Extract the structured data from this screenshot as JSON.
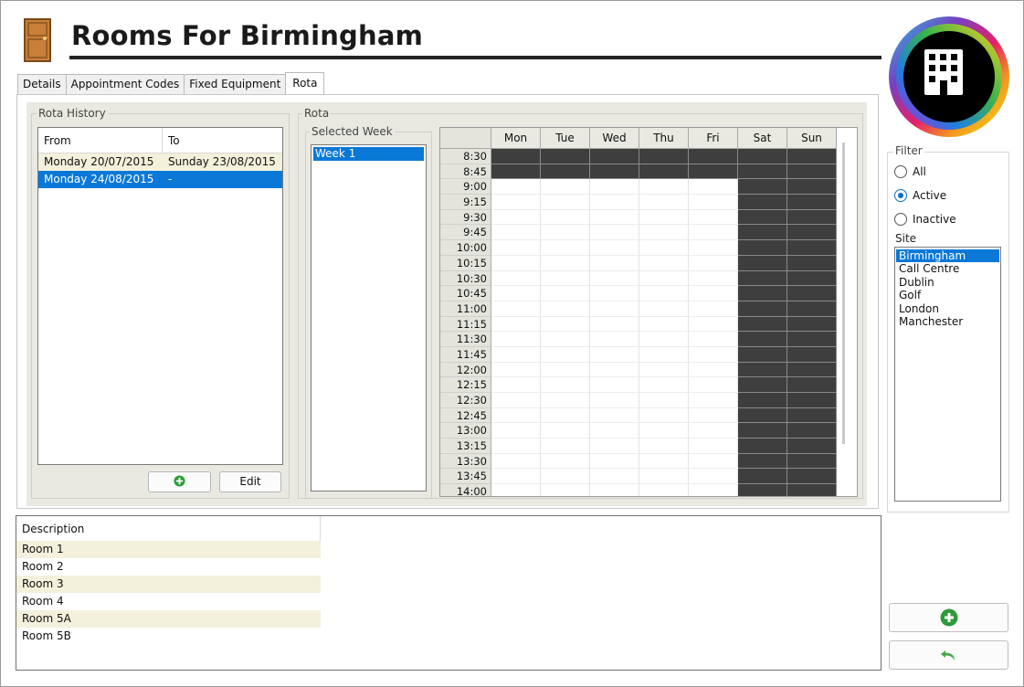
{
  "header": {
    "title": "Rooms For Birmingham"
  },
  "tabs": [
    {
      "label": "Details",
      "active": false
    },
    {
      "label": "Appointment Codes",
      "active": false
    },
    {
      "label": "Fixed Equipment",
      "active": false
    },
    {
      "label": "Rota",
      "active": true
    }
  ],
  "rota_history": {
    "group_label": "Rota History",
    "columns": [
      "From",
      "To"
    ],
    "rows": [
      {
        "from": "Monday 20/07/2015",
        "to": "Sunday 23/08/2015",
        "selected": false
      },
      {
        "from": "Monday 24/08/2015",
        "to": "-",
        "selected": true
      }
    ],
    "edit_label": "Edit"
  },
  "rota": {
    "group_label": "Rota",
    "selected_week_label": "Selected Week",
    "weeks": [
      "Week 1"
    ],
    "days": [
      "Mon",
      "Tue",
      "Wed",
      "Thu",
      "Fri",
      "Sat",
      "Sun"
    ],
    "times": [
      "8:30",
      "8:45",
      "9:00",
      "9:15",
      "9:30",
      "9:45",
      "10:00",
      "10:15",
      "10:30",
      "10:45",
      "11:00",
      "11:15",
      "11:30",
      "11:45",
      "12:00",
      "12:15",
      "12:30",
      "12:45",
      "13:00",
      "13:15",
      "13:30",
      "13:45",
      "14:00"
    ],
    "unavailable_before": "9:00",
    "unavailable_days": [
      "Sat",
      "Sun"
    ]
  },
  "description_list": {
    "header": "Description",
    "rows": [
      "Room 1",
      "Room 2",
      "Room 3",
      "Room 4",
      "Room 5A",
      "Room 5B"
    ]
  },
  "filter": {
    "label": "Filter",
    "options": [
      {
        "label": "All",
        "checked": false
      },
      {
        "label": "Active",
        "checked": true
      },
      {
        "label": "Inactive",
        "checked": false
      }
    ],
    "site_label": "Site",
    "sites": [
      "Birmingham",
      "Call Centre",
      "Dublin",
      "Golf",
      "London",
      "Manchester"
    ],
    "selected_site": "Birmingham"
  },
  "colors": {
    "accent": "#0a78d7",
    "unavailable": "#3e3e3e",
    "alt_row": "#f3f1dc",
    "add_green": "#2e9a3a"
  }
}
